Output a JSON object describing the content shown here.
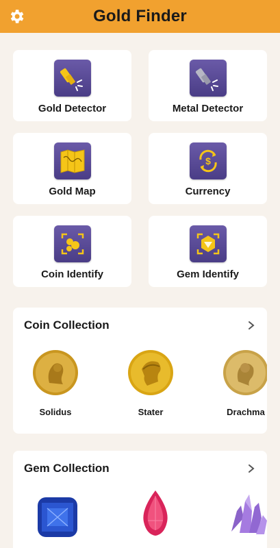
{
  "header": {
    "title": "Gold Finder",
    "settings_icon": "gear-icon"
  },
  "tools": [
    {
      "label": "Gold Detector",
      "icon": "gold-detector-icon"
    },
    {
      "label": "Metal Detector",
      "icon": "metal-detector-icon"
    },
    {
      "label": "Gold Map",
      "icon": "map-icon"
    },
    {
      "label": "Currency",
      "icon": "currency-exchange-icon"
    },
    {
      "label": "Coin Identify",
      "icon": "coin-scan-icon"
    },
    {
      "label": "Gem Identify",
      "icon": "gem-scan-icon"
    }
  ],
  "coin_collection": {
    "title": "Coin Collection",
    "items": [
      "Solidus",
      "Stater",
      "Drachma"
    ]
  },
  "gem_collection": {
    "title": "Gem Collection",
    "items": [
      "sapphire-gem",
      "ruby-gem",
      "amethyst-gem"
    ]
  },
  "colors": {
    "header": "#f1a12f",
    "icon_bg": "#5a4a98",
    "accent_gold": "#f5c518",
    "background": "#f7f2ec"
  }
}
